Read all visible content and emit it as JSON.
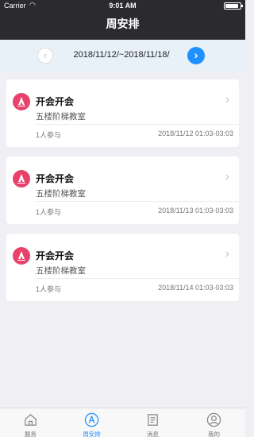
{
  "status_bar": {
    "carrier": "Carrier",
    "time": "9:01 AM",
    "battery_percent": 90
  },
  "header": {
    "title": "周安排"
  },
  "week_nav": {
    "prev_icon": "chevron-left-icon",
    "range": "2018/11/12/~2018/11/18/",
    "next_icon": "chevron-right-icon"
  },
  "colors": {
    "accent": "#1e90ff",
    "badge": "#e8426a",
    "topbar": "#2b2b2f"
  },
  "events": [
    {
      "title": "开会开会",
      "location": "五楼阶梯教室",
      "participants": "1人参与",
      "time": "2018/11/12 01:03-03:03",
      "icon": "meeting-icon"
    },
    {
      "title": "开会开会",
      "location": "五楼阶梯教室",
      "participants": "1人参与",
      "time": "2018/11/13 01:03-03:03",
      "icon": "meeting-icon"
    },
    {
      "title": "开会开会",
      "location": "五楼阶梯教室",
      "participants": "1人参与",
      "time": "2018/11/14 01:03-03:03",
      "icon": "meeting-icon"
    }
  ],
  "tabs": [
    {
      "label": "服务",
      "icon": "home-icon",
      "active": false
    },
    {
      "label": "周安排",
      "icon": "schedule-icon",
      "active": true
    },
    {
      "label": "消息",
      "icon": "message-icon",
      "active": false
    },
    {
      "label": "我的",
      "icon": "profile-icon",
      "active": false
    }
  ]
}
